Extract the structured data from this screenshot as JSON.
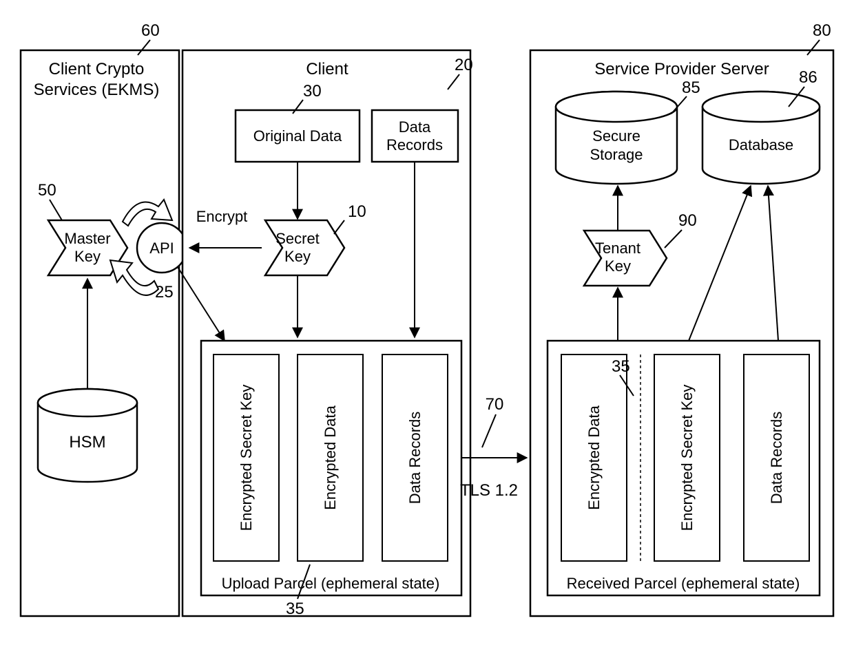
{
  "regions": {
    "ekms": {
      "title1": "Client Crypto",
      "title2": "Services (EKMS)",
      "ref": "60"
    },
    "client": {
      "title": "Client",
      "ref": "20"
    },
    "server": {
      "title": "Service Provider Server",
      "ref": "80"
    }
  },
  "nodes": {
    "master_key": {
      "label1": "Master",
      "label2": "Key",
      "ref": "50"
    },
    "api": {
      "label": "API",
      "ref": "25"
    },
    "hsm": {
      "label": "HSM"
    },
    "original_data": {
      "label": "Original Data",
      "ref": "30"
    },
    "data_records_src": {
      "label1": "Data",
      "label2": "Records"
    },
    "secret_key": {
      "label1": "Secret",
      "label2": "Key",
      "ref": "10"
    },
    "encrypt_label": "Encrypt",
    "upload_parcel": {
      "caption": "Upload Parcel (ephemeral state)",
      "ref": "35",
      "items": [
        "Encrypted Secret Key",
        "Encrypted Data",
        "Data Records"
      ]
    },
    "tenant_key": {
      "label1": "Tenant",
      "label2": "Key",
      "ref": "90"
    },
    "secure_storage": {
      "label1": "Secure",
      "label2": "Storage",
      "ref": "85"
    },
    "database": {
      "label": "Database",
      "ref": "86"
    },
    "received_parcel": {
      "caption": "Received Parcel (ephemeral state)",
      "ref": "35",
      "items": [
        "Encrypted Data",
        "Encrypted Secret Key",
        "Data Records"
      ]
    }
  },
  "link": {
    "label": "TLS 1.2",
    "ref": "70"
  }
}
